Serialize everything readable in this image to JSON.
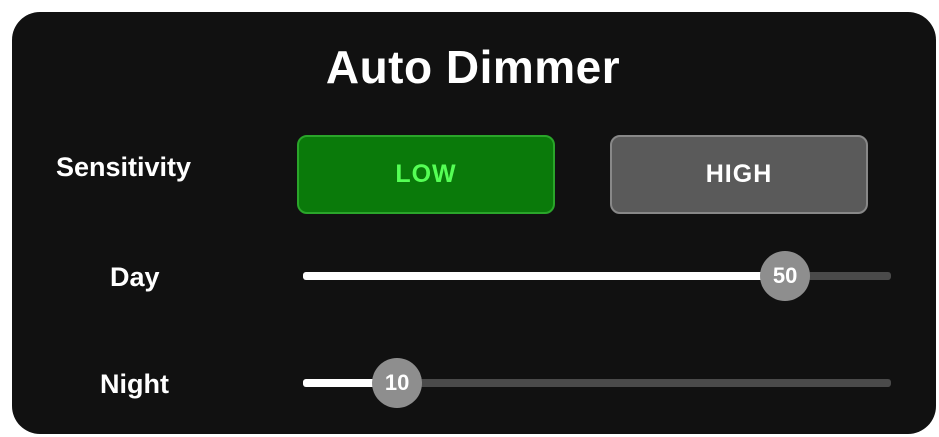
{
  "title": "Auto Dimmer",
  "sensitivity": {
    "label": "Sensitivity",
    "options": [
      "LOW",
      "HIGH"
    ],
    "selected": "LOW"
  },
  "day": {
    "label": "Day",
    "value": "50",
    "level_fraction": 0.82
  },
  "night": {
    "label": "Night",
    "value": "10",
    "level_fraction": 0.16
  },
  "colors": {
    "panel_bg": "#111111",
    "selected_bg": "#0a7a0a",
    "selected_text": "#55ff55",
    "unselected_bg": "#5a5a5a",
    "thumb": "#8e8e8e",
    "track_fill": "#ffffff",
    "track_empty": "#4a4a4a"
  }
}
